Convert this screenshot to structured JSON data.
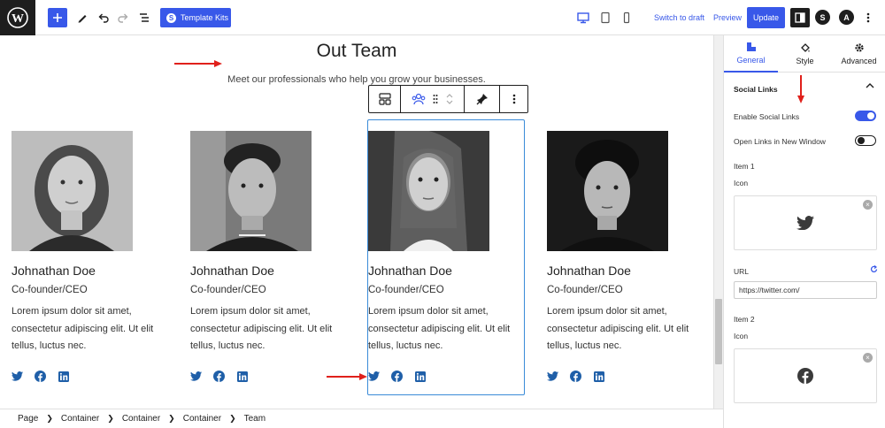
{
  "toolbar": {
    "template_kits_label": "Template Kits",
    "switch_to_draft_label": "Switch to draft",
    "preview_label": "Preview",
    "update_label": "Update"
  },
  "content": {
    "heading": "Out Team",
    "subheading": "Meet our professionals who help you grow your businesses."
  },
  "team": [
    {
      "name": "Johnathan Doe",
      "role": "Co-founder/CEO",
      "bio": "Lorem ipsum dolor sit amet, consectetur adipiscing elit. Ut elit tellus, luctus nec."
    },
    {
      "name": "Johnathan Doe",
      "role": "Co-founder/CEO",
      "bio": "Lorem ipsum dolor sit amet, consectetur adipiscing elit. Ut elit tellus, luctus nec."
    },
    {
      "name": "Johnathan Doe",
      "role": "Co-founder/CEO",
      "bio": "Lorem ipsum dolor sit amet, consectetur adipiscing elit. Ut elit tellus, luctus nec."
    },
    {
      "name": "Johnathan Doe",
      "role": "Co-founder/CEO",
      "bio": "Lorem ipsum dolor sit amet, consectetur adipiscing elit. Ut elit tellus, luctus nec."
    }
  ],
  "breadcrumb": [
    "Page",
    "Container",
    "Container",
    "Container",
    "Team"
  ],
  "sidebar": {
    "tabs": [
      {
        "label": "General",
        "icon": "general-icon",
        "active": true
      },
      {
        "label": "Style",
        "icon": "style-icon",
        "active": false
      },
      {
        "label": "Advanced",
        "icon": "gear-icon",
        "active": false
      }
    ],
    "section_title": "Social Links",
    "enable_social_links_label": "Enable Social Links",
    "enable_social_links": true,
    "open_new_window_label": "Open Links in New Window",
    "open_new_window": false,
    "item1_label": "Item 1",
    "item1_icon_label": "Icon",
    "item1_icon": "twitter-icon",
    "url_label": "URL",
    "url_value": "https://twitter.com/",
    "item2_label": "Item 2",
    "item2_icon_label": "Icon",
    "item2_icon": "facebook-icon"
  },
  "colors": {
    "accent": "#3858e9",
    "social_icon": "#1f5fa8",
    "arrow": "#e0201b"
  }
}
